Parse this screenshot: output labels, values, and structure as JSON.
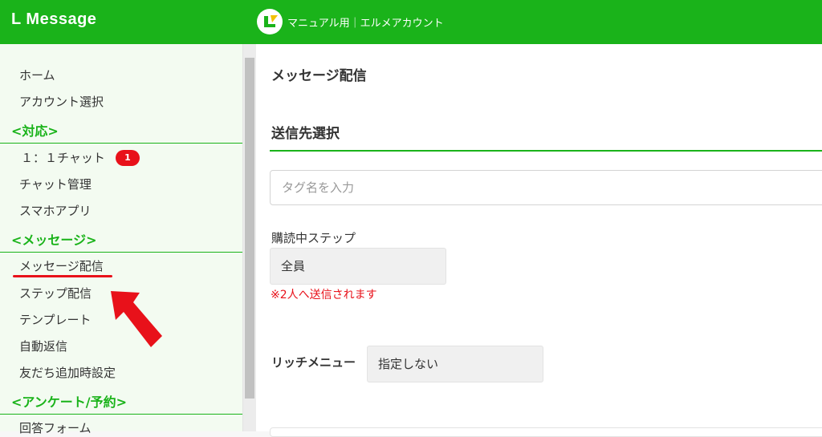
{
  "app": {
    "title": "L Message"
  },
  "account": {
    "name": "マニュアル用｜エルメアカウント",
    "logo_icon": "lmessage-logo-icon"
  },
  "sidebar": {
    "items": [
      {
        "type": "link",
        "label": "ホーム"
      },
      {
        "type": "link",
        "label": "アカウント選択"
      },
      {
        "type": "section",
        "label": "<対応>"
      },
      {
        "type": "link",
        "label": "１：１チャット",
        "badge": "1"
      },
      {
        "type": "link",
        "label": "チャット管理"
      },
      {
        "type": "link",
        "label": "スマホアプリ"
      },
      {
        "type": "section",
        "label": "<メッセージ>"
      },
      {
        "type": "link",
        "label": "メッセージ配信",
        "highlighted": true
      },
      {
        "type": "link",
        "label": "ステップ配信"
      },
      {
        "type": "link",
        "label": "テンプレート"
      },
      {
        "type": "link",
        "label": "自動返信"
      },
      {
        "type": "link",
        "label": "友だち追加時設定"
      },
      {
        "type": "section",
        "label": "<アンケート/予約>"
      },
      {
        "type": "link",
        "label": "回答フォーム"
      }
    ]
  },
  "main": {
    "page_title": "メッセージ配信",
    "section_title": "送信先選択",
    "tag_search": {
      "placeholder": "タグ名を入力",
      "value": ""
    },
    "step": {
      "label": "購読中ステップ",
      "selected": "全員"
    },
    "notice": "※2人へ送信されます",
    "rich_menu": {
      "label": "リッチメニュー",
      "selected": "指定しない"
    }
  },
  "colors": {
    "brand": "#1ab31a",
    "alert": "#e8111a",
    "sidebar_bg": "#f3fbf1"
  }
}
